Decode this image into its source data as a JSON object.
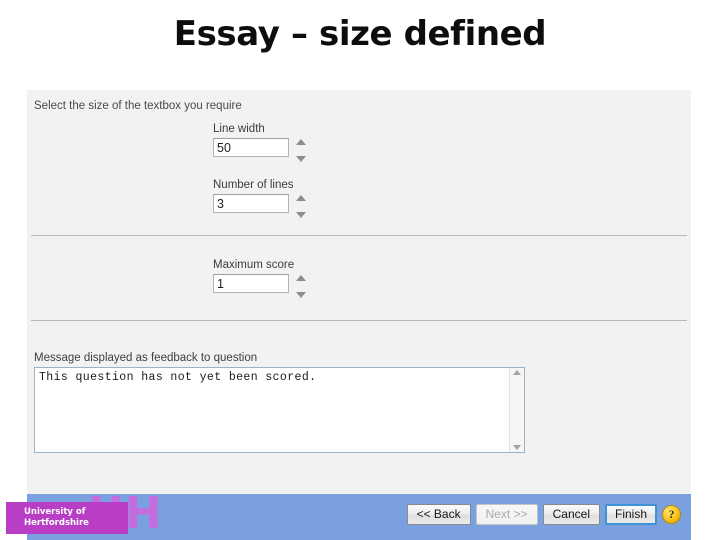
{
  "slide": {
    "title": "Essay – size defined"
  },
  "dialog": {
    "intro_label": "Select the size of the textbox you require",
    "fields": [
      {
        "label": "Line width",
        "value": "50"
      },
      {
        "label": "Number of lines",
        "value": "3"
      },
      {
        "label": "Maximum score",
        "value": "1"
      }
    ],
    "feedback": {
      "label": "Message displayed as feedback to question",
      "value": "This question has not yet been scored.",
      "scroll_up_icon": "scroll-up-arrow-icon",
      "scroll_down_icon": "scroll-down-arrow-icon"
    },
    "spinner_icons": {
      "up": "spinner-up-arrow-icon",
      "down": "spinner-down-arrow-icon"
    },
    "footer": {
      "back_label": "<< Back",
      "next_label": "Next >>",
      "cancel_label": "Cancel",
      "finish_label": "Finish",
      "help_label": "?",
      "bar_color": "#7ba0e0"
    }
  },
  "logo": {
    "mark": "UH",
    "name": "University of\nHertfordshire",
    "badge_color": "#b93ec6",
    "mark_color": "#c46ce0"
  }
}
